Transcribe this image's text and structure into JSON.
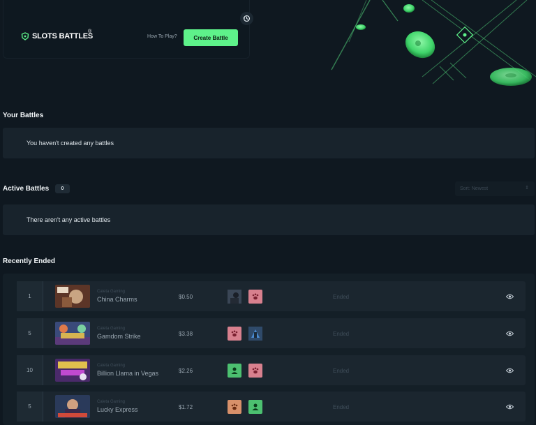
{
  "header": {
    "logo_text": "SLOTS BATTLES",
    "logo_reg": "®",
    "how_to_play": "How To Play?",
    "create_battle": "Create Battle",
    "history_icon": "history-icon",
    "accent_color": "#5ef28a"
  },
  "your_battles": {
    "title": "Your Battles",
    "empty": "You haven't created any battles"
  },
  "active_battles": {
    "title": "Active Battles",
    "count": "0",
    "empty": "There aren't any active battles",
    "sort": "Sort: Newest"
  },
  "recently_ended": {
    "title": "Recently Ended",
    "rows": [
      {
        "num": "1",
        "provider": "Caleta Gaming",
        "game": "China Charms",
        "price": "$0.50",
        "status": "Ended"
      },
      {
        "num": "5",
        "provider": "Caleta Gaming",
        "game": "Gamdom Strike",
        "price": "$3.38",
        "status": "Ended"
      },
      {
        "num": "10",
        "provider": "Caleta Gaming",
        "game": "Billion Llama in Vegas",
        "price": "$2.26",
        "status": "Ended"
      },
      {
        "num": "5",
        "provider": "Caleta Gaming",
        "game": "Lucky Express",
        "price": "$1.72",
        "status": "Ended"
      }
    ]
  }
}
